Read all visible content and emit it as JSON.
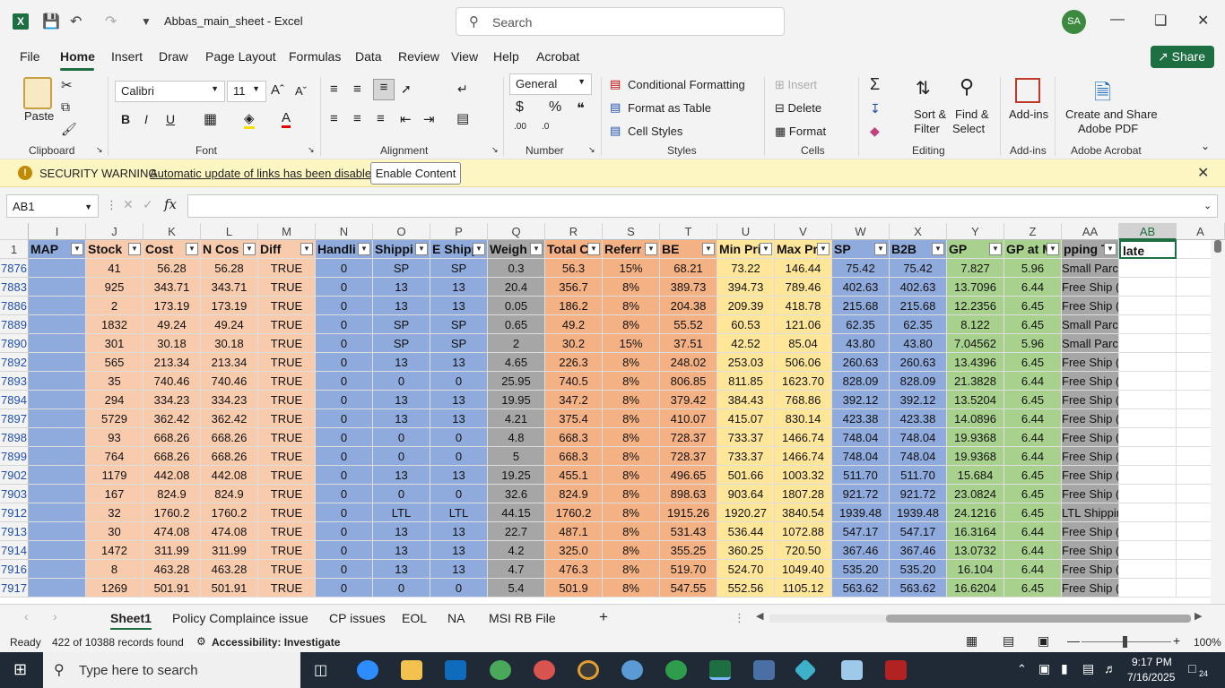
{
  "window": {
    "title": "Abbas_main_sheet  -  Excel",
    "search_placeholder": "Search",
    "avatar_initials": "SA"
  },
  "menu": {
    "items": [
      "File",
      "Home",
      "Insert",
      "Draw",
      "Page Layout",
      "Formulas",
      "Data",
      "Review",
      "View",
      "Help",
      "Acrobat"
    ],
    "share_label": "Share"
  },
  "ribbon": {
    "paste": "Paste",
    "font_name": "Calibri",
    "font_size": "11",
    "number_format": "General",
    "conditional_formatting": "Conditional Formatting",
    "format_as_table": "Format as Table",
    "cell_styles": "Cell Styles",
    "insert": "Insert",
    "delete": "Delete",
    "format": "Format",
    "sort_filter": "Sort &",
    "sort_filter2": "Filter",
    "find_select": "Find &",
    "find_select2": "Select",
    "addins": "Add-ins",
    "create_pdf": "Create and Share",
    "create_pdf2": "Adobe PDF",
    "groups": {
      "clipboard": "Clipboard",
      "font": "Font",
      "alignment": "Alignment",
      "number": "Number",
      "styles": "Styles",
      "cells": "Cells",
      "editing": "Editing",
      "addins": "Add-ins",
      "acrobat": "Adobe Acrobat"
    }
  },
  "security": {
    "title": "SECURITY WARNING",
    "message": "Automatic update of links has been disabled",
    "button": "Enable Content"
  },
  "formula_bar": {
    "name_box": "AB1",
    "fx": "fx",
    "content": ""
  },
  "grid": {
    "columns": [
      "I",
      "J",
      "K",
      "L",
      "M",
      "N",
      "O",
      "P",
      "Q",
      "R",
      "S",
      "T",
      "U",
      "V",
      "W",
      "X",
      "Y",
      "Z",
      "AA",
      "AB",
      "A"
    ],
    "headers": [
      "MAP",
      "Stock",
      "Cost",
      "N Cos",
      "Diff",
      "Handli",
      "Shippi",
      "E Shipp",
      "Weigh",
      "Total C",
      "Referr",
      "BE",
      "Min Pri",
      "Max Pri",
      "SP",
      "B2B",
      "GP",
      "GP at M",
      "pping Te",
      "late",
      ""
    ],
    "rows": [
      {
        "num": "1"
      },
      {
        "num": "7876",
        "cells": [
          "",
          "41",
          "56.28",
          "56.28",
          "TRUE",
          "0",
          "SP",
          "SP",
          "0.3",
          "56.3",
          "15%",
          "68.21",
          "73.22",
          "146.44",
          "75.42",
          "75.42",
          "7.827",
          "5.96",
          "Small Parcel",
          ""
        ]
      },
      {
        "num": "7883",
        "cells": [
          "",
          "925",
          "343.71",
          "343.71",
          "TRUE",
          "0",
          "13",
          "13",
          "20.4",
          "356.7",
          "8%",
          "389.73",
          "394.73",
          "789.46",
          "402.63",
          "402.63",
          "13.7096",
          "6.44",
          "Free Ship (BuyBox)",
          ""
        ]
      },
      {
        "num": "7886",
        "cells": [
          "",
          "2",
          "173.19",
          "173.19",
          "TRUE",
          "0",
          "13",
          "13",
          "0.05",
          "186.2",
          "8%",
          "204.38",
          "209.39",
          "418.78",
          "215.68",
          "215.68",
          "12.2356",
          "6.45",
          "Free Ship (BuyBox)",
          ""
        ]
      },
      {
        "num": "7889",
        "cells": [
          "",
          "1832",
          "49.24",
          "49.24",
          "TRUE",
          "0",
          "SP",
          "SP",
          "0.65",
          "49.2",
          "8%",
          "55.52",
          "60.53",
          "121.06",
          "62.35",
          "62.35",
          "8.122",
          "6.45",
          "Small Parcel",
          ""
        ]
      },
      {
        "num": "7890",
        "cells": [
          "",
          "301",
          "30.18",
          "30.18",
          "TRUE",
          "0",
          "SP",
          "SP",
          "2",
          "30.2",
          "15%",
          "37.51",
          "42.52",
          "85.04",
          "43.80",
          "43.80",
          "7.04562",
          "5.96",
          "Small Parcel",
          ""
        ]
      },
      {
        "num": "7892",
        "cells": [
          "",
          "565",
          "213.34",
          "213.34",
          "TRUE",
          "0",
          "13",
          "13",
          "4.65",
          "226.3",
          "8%",
          "248.02",
          "253.03",
          "506.06",
          "260.63",
          "260.63",
          "13.4396",
          "6.45",
          "Free Ship (BuyBox)",
          ""
        ]
      },
      {
        "num": "7893",
        "cells": [
          "",
          "35",
          "740.46",
          "740.46",
          "TRUE",
          "0",
          "0",
          "0",
          "25.95",
          "740.5",
          "8%",
          "806.85",
          "811.85",
          "1623.70",
          "828.09",
          "828.09",
          "21.3828",
          "6.44",
          "Free Ship (BuyBox)",
          ""
        ]
      },
      {
        "num": "7894",
        "cells": [
          "",
          "294",
          "334.23",
          "334.23",
          "TRUE",
          "0",
          "13",
          "13",
          "19.95",
          "347.2",
          "8%",
          "379.42",
          "384.43",
          "768.86",
          "392.12",
          "392.12",
          "13.5204",
          "6.45",
          "Free Ship (BuyBox)",
          ""
        ]
      },
      {
        "num": "7897",
        "cells": [
          "",
          "5729",
          "362.42",
          "362.42",
          "TRUE",
          "0",
          "13",
          "13",
          "4.21",
          "375.4",
          "8%",
          "410.07",
          "415.07",
          "830.14",
          "423.38",
          "423.38",
          "14.0896",
          "6.44",
          "Free Ship (BuyBox)",
          ""
        ]
      },
      {
        "num": "7898",
        "cells": [
          "",
          "93",
          "668.26",
          "668.26",
          "TRUE",
          "0",
          "0",
          "0",
          "4.8",
          "668.3",
          "8%",
          "728.37",
          "733.37",
          "1466.74",
          "748.04",
          "748.04",
          "19.9368",
          "6.44",
          "Free Ship (BuyBox)",
          ""
        ]
      },
      {
        "num": "7899",
        "cells": [
          "",
          "764",
          "668.26",
          "668.26",
          "TRUE",
          "0",
          "0",
          "0",
          "5",
          "668.3",
          "8%",
          "728.37",
          "733.37",
          "1466.74",
          "748.04",
          "748.04",
          "19.9368",
          "6.44",
          "Free Ship (BuyBox)",
          ""
        ]
      },
      {
        "num": "7902",
        "cells": [
          "",
          "1179",
          "442.08",
          "442.08",
          "TRUE",
          "0",
          "13",
          "13",
          "19.25",
          "455.1",
          "8%",
          "496.65",
          "501.66",
          "1003.32",
          "511.70",
          "511.70",
          "15.684",
          "6.45",
          "Free Ship (BuyBox)",
          ""
        ]
      },
      {
        "num": "7903",
        "cells": [
          "",
          "167",
          "824.9",
          "824.9",
          "TRUE",
          "0",
          "0",
          "0",
          "32.6",
          "824.9",
          "8%",
          "898.63",
          "903.64",
          "1807.28",
          "921.72",
          "921.72",
          "23.0824",
          "6.45",
          "Free Ship (BuyBox)",
          ""
        ]
      },
      {
        "num": "7912",
        "cells": [
          "",
          "32",
          "1760.2",
          "1760.2",
          "TRUE",
          "0",
          "LTL",
          "LTL",
          "44.15",
          "1760.2",
          "8%",
          "1915.26",
          "1920.27",
          "3840.54",
          "1939.48",
          "1939.48",
          "24.1216",
          "6.45",
          "LTL Shipping",
          ""
        ]
      },
      {
        "num": "7913",
        "cells": [
          "",
          "30",
          "474.08",
          "474.08",
          "TRUE",
          "0",
          "13",
          "13",
          "22.7",
          "487.1",
          "8%",
          "531.43",
          "536.44",
          "1072.88",
          "547.17",
          "547.17",
          "16.3164",
          "6.44",
          "Free Ship (BuyBox)",
          ""
        ]
      },
      {
        "num": "7914",
        "cells": [
          "",
          "1472",
          "311.99",
          "311.99",
          "TRUE",
          "0",
          "13",
          "13",
          "4.2",
          "325.0",
          "8%",
          "355.25",
          "360.25",
          "720.50",
          "367.46",
          "367.46",
          "13.0732",
          "6.44",
          "Free Ship (BuyBox)",
          ""
        ]
      },
      {
        "num": "7916",
        "cells": [
          "",
          "8",
          "463.28",
          "463.28",
          "TRUE",
          "0",
          "13",
          "13",
          "4.7",
          "476.3",
          "8%",
          "519.70",
          "524.70",
          "1049.40",
          "535.20",
          "535.20",
          "16.104",
          "6.44",
          "Free Ship (BuyBox)",
          ""
        ]
      },
      {
        "num": "7917",
        "cells": [
          "",
          "1269",
          "501.91",
          "501.91",
          "TRUE",
          "0",
          "0",
          "0",
          "5.4",
          "501.9",
          "8%",
          "547.55",
          "552.56",
          "1105.12",
          "563.62",
          "563.62",
          "16.6204",
          "6.45",
          "Free Ship (BuyBox)",
          ""
        ]
      }
    ]
  },
  "sheets": {
    "tabs": [
      "Sheet1",
      "Policy Complaince issue",
      "CP issues",
      "EOL",
      "NA",
      "MSI RB File"
    ],
    "add": "+"
  },
  "status": {
    "ready": "Ready",
    "records": "422 of 10388 records found",
    "accessibility": "Accessibility: Investigate",
    "zoom": "100%"
  },
  "taskbar": {
    "search_placeholder": "Type here to search",
    "time": "9:17 PM",
    "date": "7/16/2025",
    "notifications": "24"
  }
}
